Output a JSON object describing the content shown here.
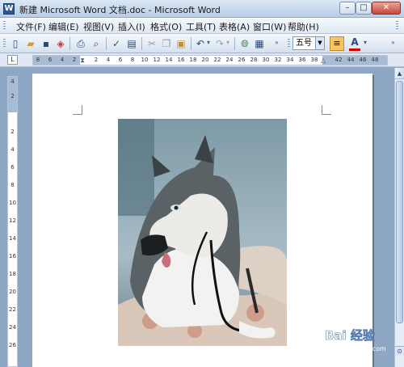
{
  "window": {
    "title": "新建 Microsoft Word 文档.doc - Microsoft Word",
    "app_icon_letter": "W",
    "minimize": "–",
    "maximize": "□",
    "close": "✕"
  },
  "menu": {
    "items": [
      "文件(F)",
      "编辑(E)",
      "视图(V)",
      "插入(I)",
      "格式(O)",
      "工具(T)",
      "表格(A)",
      "窗口(W)",
      "帮助(H)"
    ]
  },
  "toolbar": {
    "icons": [
      "new-doc-icon",
      "open-icon",
      "save-icon",
      "permission-icon",
      "print-icon",
      "print-preview-icon",
      "spelling-icon",
      "research-icon",
      "cut-icon",
      "copy-icon",
      "paste-icon",
      "undo-icon",
      "redo-icon",
      "hyperlink-icon",
      "table-icon"
    ],
    "font_size": "五号",
    "dropdown_arrow": "▼",
    "align_glyph": "≡",
    "font_color_letter": "A"
  },
  "ruler": {
    "corner_label": "L",
    "h_left_numbers": [
      "8",
      "6",
      "4",
      "2"
    ],
    "h_numbers": [
      "2",
      "4",
      "6",
      "8",
      "10",
      "12",
      "14",
      "16",
      "18",
      "20",
      "22",
      "24",
      "26",
      "28",
      "30",
      "32",
      "34",
      "36",
      "38"
    ],
    "h_right_numbers": [
      "42",
      "44",
      "46",
      "48"
    ],
    "v_top_numbers": [
      "4",
      "2"
    ],
    "v_numbers": [
      "2",
      "4",
      "6",
      "8",
      "10",
      "12",
      "14",
      "16",
      "18",
      "20",
      "22",
      "24",
      "26"
    ]
  },
  "document": {
    "image_subject": "husky dog with stethoscope"
  },
  "scrollbar": {
    "up_arrow": "▲",
    "prev_page": "⊙"
  },
  "watermark": {
    "text": "Bai 经验",
    "url": "jingyan.baidu.com"
  },
  "colors": {
    "titlebar": "#c6d8ee",
    "workspace": "#8ea7c4",
    "close_button": "#c4483a"
  }
}
